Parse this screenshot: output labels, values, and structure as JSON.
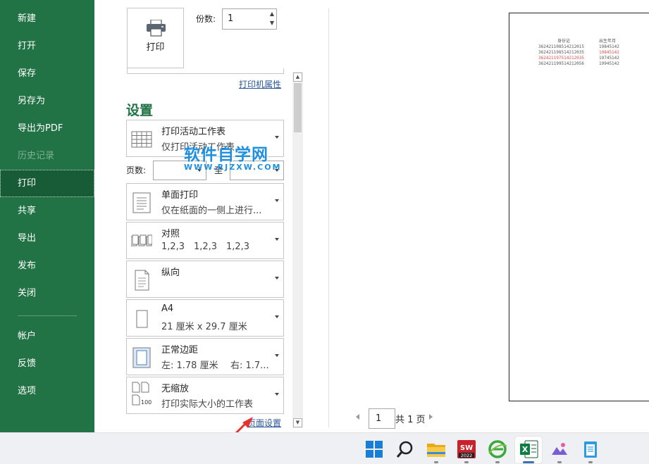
{
  "sidebar": {
    "items": [
      {
        "label": "新建"
      },
      {
        "label": "打开"
      },
      {
        "label": "保存"
      },
      {
        "label": "另存为"
      },
      {
        "label": "导出为PDF"
      },
      {
        "label": "历史记录"
      },
      {
        "label": "打印"
      },
      {
        "label": "共享"
      },
      {
        "label": "导出"
      },
      {
        "label": "发布"
      },
      {
        "label": "关闭"
      },
      {
        "label": "帐户"
      },
      {
        "label": "反馈"
      },
      {
        "label": "选项"
      }
    ],
    "active_item": "打印",
    "disabled_item": "历史记录",
    "accent_color": "#217346"
  },
  "print": {
    "button_label": "打印",
    "copies_label": "份数:",
    "copies_value": "1",
    "printer_properties_link": "打印机属性"
  },
  "settings": {
    "title": "设置",
    "what_to_print": {
      "title": "打印活动工作表",
      "subtitle": "仅打印活动工作表",
      "icon": "sheet-grid-icon"
    },
    "pages_label": "页数:",
    "pages_to_label": "至",
    "sides": {
      "title": "单面打印",
      "subtitle": "仅在纸面的一侧上进行...",
      "icon": "one-sided-page-icon"
    },
    "collation": {
      "title": "对照",
      "subtitle_parts": [
        "1,2,3",
        "1,2,3",
        "1,2,3"
      ],
      "icon": "collated-pages-icon"
    },
    "orientation": {
      "title": "纵向",
      "subtitle": "",
      "icon": "portrait-page-icon"
    },
    "paper_size": {
      "title": "A4",
      "subtitle": "21 厘米 x 29.7 厘米",
      "icon": "paper-size-icon"
    },
    "margins": {
      "title": "正常边距",
      "subtitle_left": "左: 1.78 厘米",
      "subtitle_right": "右: 1.7...",
      "icon": "margins-icon"
    },
    "scaling": {
      "title": "无缩放",
      "subtitle": "打印实际大小的工作表",
      "icon": "no-scaling-icon",
      "icon_text": "100"
    },
    "page_setup_link": "页面设置"
  },
  "watermark": {
    "line1": "软件自学网",
    "line2": "WWW.RJZXW.COM"
  },
  "preview": {
    "header_id": "身份证",
    "header_birth": "出生年月",
    "rows": [
      {
        "id": "362421108514212015",
        "birth": "19845142",
        "highlight": false
      },
      {
        "id": "362421198514212035",
        "birth": "19845142",
        "highlight": true
      },
      {
        "id": "362421197514212035",
        "birth": "19745142",
        "highlight": true
      },
      {
        "id": "362421199514212056",
        "birth": "19945142",
        "highlight": false
      }
    ],
    "page_current": "1",
    "page_total": "共 1 页"
  },
  "taskbar": {
    "icons": [
      "windows-start-icon",
      "search-icon",
      "file-explorer-icon",
      "solidworks-2022-icon",
      "browser-icon",
      "excel-icon",
      "photos-icon",
      "notepad-icon"
    ],
    "solidworks_label": "2022"
  }
}
